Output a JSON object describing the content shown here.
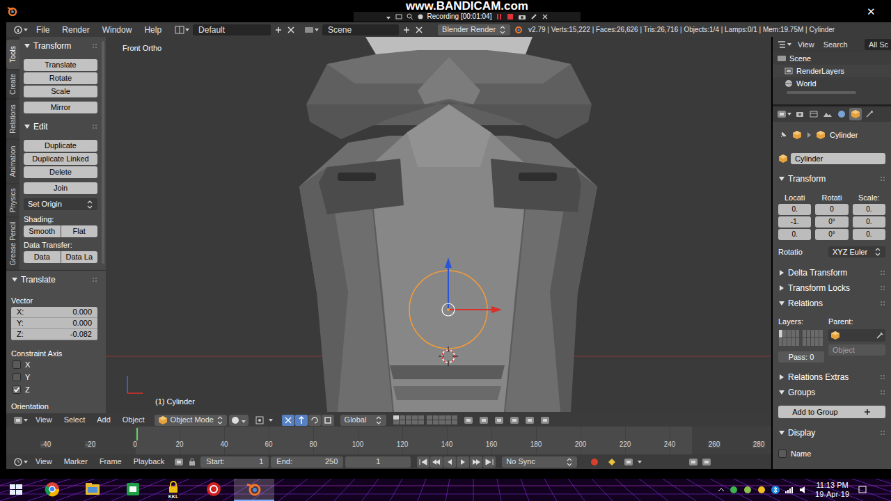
{
  "window": {
    "close": "✕"
  },
  "recorder": {
    "watermark": "www.BANDICAM.com",
    "status": "Recording [00:01:04]"
  },
  "info_header": {
    "menus": [
      "File",
      "Render",
      "Window",
      "Help"
    ],
    "layout": "Default",
    "scene": "Scene",
    "engine": "Blender Render",
    "stats": "v2.79 | Verts:15,222 | Faces:26,626 | Tris:26,716 | Objects:1/4 | Lamps:0/1 | Mem:19.75M | Cylinder"
  },
  "tool_tabs": [
    {
      "label": "Tools",
      "selected": true
    },
    {
      "label": "Create",
      "selected": false
    },
    {
      "label": "Relations",
      "selected": false
    },
    {
      "label": "Animation",
      "selected": false
    },
    {
      "label": "Physics",
      "selected": false
    },
    {
      "label": "Grease Pencil",
      "selected": false
    }
  ],
  "tool_shelf": {
    "transform": {
      "title": "Transform",
      "expanded": true,
      "buttons": [
        "Translate",
        "Rotate",
        "Scale"
      ],
      "extra": "Mirror"
    },
    "edit": {
      "title": "Edit",
      "expanded": true,
      "buttons": [
        "Duplicate",
        "Duplicate Linked",
        "Delete"
      ],
      "join": "Join",
      "set_origin": "Set Origin",
      "shading_label": "Shading:",
      "shading": [
        "Smooth",
        "Flat"
      ],
      "data_label": "Data Transfer:",
      "data": [
        "Data",
        "Data La"
      ]
    }
  },
  "operator": {
    "title": "Translate",
    "expanded": true,
    "vector_label": "Vector",
    "vector": [
      {
        "axis": "X:",
        "value": "0.000"
      },
      {
        "axis": "Y:",
        "value": "0.000"
      },
      {
        "axis": "Z:",
        "value": "-0.082"
      }
    ],
    "constraint_label": "Constraint Axis",
    "constraint": [
      {
        "axis": "X",
        "checked": false
      },
      {
        "axis": "Y",
        "checked": false
      },
      {
        "axis": "Z",
        "checked": true
      }
    ],
    "orientation_label": "Orientation"
  },
  "viewport": {
    "view_name": "Front Ortho",
    "object_label": "(1) Cylinder"
  },
  "viewport_header": {
    "menus": [
      "View",
      "Select",
      "Add",
      "Object"
    ],
    "mode": "Object Mode",
    "orientation": "Global",
    "manipulators": [
      {
        "selected": true
      },
      {
        "selected": true
      },
      {
        "selected": false
      },
      {
        "selected": false
      }
    ]
  },
  "timeline": {
    "ticks": [
      "-40",
      "-20",
      "0",
      "20",
      "40",
      "60",
      "80",
      "100",
      "120",
      "140",
      "160",
      "180",
      "200",
      "220",
      "240",
      "260",
      "280"
    ],
    "cursor_frame": 1
  },
  "timeline_header": {
    "menus": [
      "View",
      "Marker",
      "Frame",
      "Playback"
    ],
    "start_label": "Start:",
    "start": "1",
    "end_label": "End:",
    "end": "250",
    "current": "1",
    "sync": "No Sync"
  },
  "outliner": {
    "menus": [
      "View",
      "Search"
    ],
    "filter": "All Sc",
    "items": [
      {
        "label": "Scene",
        "selected": false
      },
      {
        "label": "RenderLayers",
        "selected": false
      },
      {
        "label": "World",
        "selected": false
      }
    ]
  },
  "properties": {
    "editor_tabs": [
      {
        "selected": false
      },
      {
        "selected": false
      },
      {
        "selected": false
      },
      {
        "selected": false
      },
      {
        "selected": true
      },
      {
        "selected": false
      }
    ],
    "breadcrumb": "Cylinder",
    "name": "Cylinder",
    "transform_title": "Transform",
    "transform_expanded": true,
    "columns": [
      {
        "label": "Locati",
        "values": [
          "0.",
          "-1.",
          "0."
        ]
      },
      {
        "label": "Rotati",
        "values": [
          "0",
          "0°",
          "0°"
        ]
      },
      {
        "label": "Scale:",
        "values": [
          "0.",
          "0.",
          "0."
        ]
      }
    ],
    "rotation_label": "Rotatio",
    "rotation_mode": "XYZ Euler",
    "panels": [
      {
        "title": "Delta Transform",
        "expanded": false
      },
      {
        "title": "Transform Locks",
        "expanded": false
      },
      {
        "title": "Relations",
        "expanded": true
      },
      {
        "title": "Relations Extras",
        "expanded": false
      },
      {
        "title": "Groups",
        "expanded": true
      },
      {
        "title": "Display",
        "expanded": true
      }
    ],
    "relations": {
      "layers_label": "Layers:",
      "parent_label": "Parent:",
      "parent_type": "Object",
      "pass": "Pass: 0"
    },
    "groups": {
      "button": "Add to Group"
    },
    "display": {
      "name_label": "Name",
      "name_checked": false
    }
  },
  "taskbar": {
    "apps": [
      {
        "label": "",
        "selected": false
      },
      {
        "label": "",
        "selected": false
      },
      {
        "label": "",
        "selected": false
      },
      {
        "label": "KKL",
        "selected": false
      },
      {
        "label": "",
        "selected": false
      },
      {
        "label": "",
        "selected": true
      }
    ],
    "time": "11:13 PM",
    "date": "19-Apr-19"
  }
}
